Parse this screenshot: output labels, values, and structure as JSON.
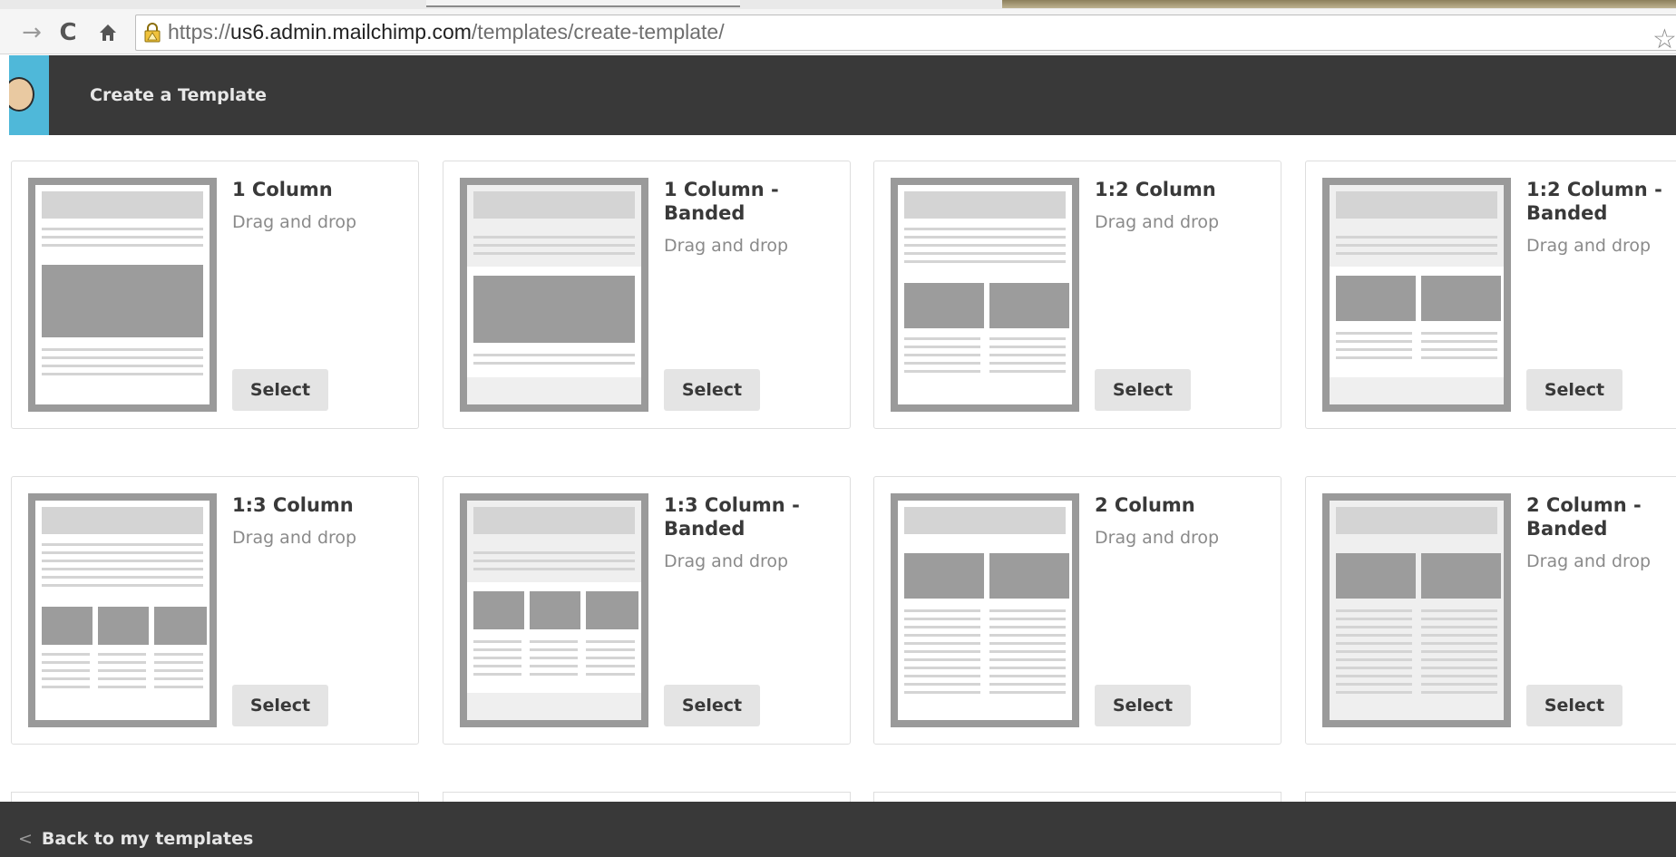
{
  "browser": {
    "url_scheme": "https://",
    "url_host": "us6.admin.mailchimp.com",
    "url_path": "/templates/create-template/",
    "forward_icon": "forward-arrow-icon",
    "reload_icon": "reload-icon",
    "home_icon": "home-icon",
    "lock_icon": "lock-warning-icon",
    "star_icon": "bookmark-star-icon"
  },
  "header": {
    "title": "Create a Template",
    "logo_icon": "mailchimp-logo-icon",
    "background": "#393939",
    "logo_background": "#4fb8d9"
  },
  "templates": [
    {
      "title": "1 Column",
      "subtitle": "Drag and drop",
      "button": "Select"
    },
    {
      "title": "1 Column - Banded",
      "subtitle": "Drag and drop",
      "button": "Select"
    },
    {
      "title": "1:2 Column",
      "subtitle": "Drag and drop",
      "button": "Select"
    },
    {
      "title": "1:2 Column - Banded",
      "subtitle": "Drag and drop",
      "button": "Select"
    },
    {
      "title": "1:3 Column",
      "subtitle": "Drag and drop",
      "button": "Select"
    },
    {
      "title": "1:3 Column - Banded",
      "subtitle": "Drag and drop",
      "button": "Select"
    },
    {
      "title": "2 Column",
      "subtitle": "Drag and drop",
      "button": "Select"
    },
    {
      "title": "2 Column - Banded",
      "subtitle": "Drag and drop",
      "button": "Select"
    }
  ],
  "footer": {
    "back_label": "Back to my templates",
    "back_icon": "chevron-left-icon"
  }
}
